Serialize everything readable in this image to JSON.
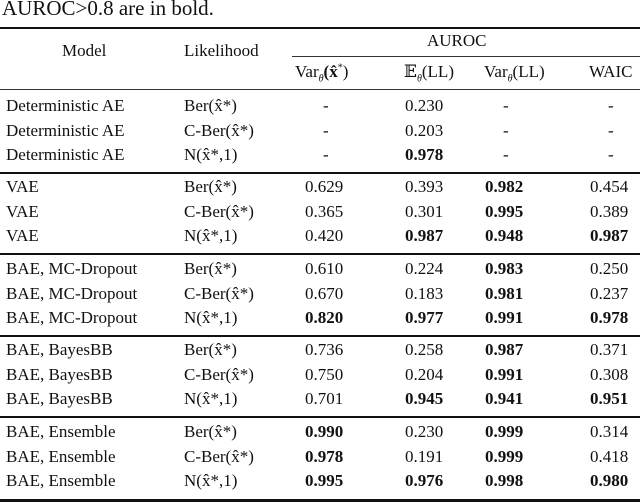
{
  "caption": "AUROC>0.8 are in bold.",
  "header": {
    "model": "Model",
    "likelihood": "Likelihood",
    "auroc_group": "AUROC",
    "columns": [
      {
        "base": "Var",
        "sub": "θ",
        "arg": "(x̂",
        "sup": "*",
        "close": ")"
      },
      {
        "base": "𝔼",
        "sub": "θ",
        "arg": "(LL)"
      },
      {
        "base": "Var",
        "sub": "θ",
        "arg": "(LL)"
      },
      {
        "label": "WAIC"
      }
    ]
  },
  "rows": [
    {
      "model": "Deterministic AE",
      "likelihood": "Ber(x̂*)",
      "values": [
        "-",
        "0.230",
        "-",
        "-"
      ],
      "bold": [
        false,
        false,
        false,
        false
      ]
    },
    {
      "model": "Deterministic AE",
      "likelihood": "C-Ber(x̂*)",
      "values": [
        "-",
        "0.203",
        "-",
        "-"
      ],
      "bold": [
        false,
        false,
        false,
        false
      ]
    },
    {
      "model": "Deterministic AE",
      "likelihood": "N(x̂*,1)",
      "values": [
        "-",
        "0.978",
        "-",
        "-"
      ],
      "bold": [
        false,
        true,
        false,
        false
      ]
    },
    {
      "model": "VAE",
      "likelihood": "Ber(x̂*)",
      "values": [
        "0.629",
        "0.393",
        "0.982",
        "0.454"
      ],
      "bold": [
        false,
        false,
        true,
        false
      ]
    },
    {
      "model": "VAE",
      "likelihood": "C-Ber(x̂*)",
      "values": [
        "0.365",
        "0.301",
        "0.995",
        "0.389"
      ],
      "bold": [
        false,
        false,
        true,
        false
      ]
    },
    {
      "model": "VAE",
      "likelihood": "N(x̂*,1)",
      "values": [
        "0.420",
        "0.987",
        "0.948",
        "0.987"
      ],
      "bold": [
        false,
        true,
        true,
        true
      ]
    },
    {
      "model": "BAE, MC-Dropout",
      "likelihood": "Ber(x̂*)",
      "values": [
        "0.610",
        "0.224",
        "0.983",
        "0.250"
      ],
      "bold": [
        false,
        false,
        true,
        false
      ]
    },
    {
      "model": "BAE, MC-Dropout",
      "likelihood": "C-Ber(x̂*)",
      "values": [
        "0.670",
        "0.183",
        "0.981",
        "0.237"
      ],
      "bold": [
        false,
        false,
        true,
        false
      ]
    },
    {
      "model": "BAE, MC-Dropout",
      "likelihood": "N(x̂*,1)",
      "values": [
        "0.820",
        "0.977",
        "0.991",
        "0.978"
      ],
      "bold": [
        true,
        true,
        true,
        true
      ]
    },
    {
      "model": "BAE, BayesBB",
      "likelihood": "Ber(x̂*)",
      "values": [
        "0.736",
        "0.258",
        "0.987",
        "0.371"
      ],
      "bold": [
        false,
        false,
        true,
        false
      ]
    },
    {
      "model": "BAE, BayesBB",
      "likelihood": "C-Ber(x̂*)",
      "values": [
        "0.750",
        "0.204",
        "0.991",
        "0.308"
      ],
      "bold": [
        false,
        false,
        true,
        false
      ]
    },
    {
      "model": "BAE, BayesBB",
      "likelihood": "N(x̂*,1)",
      "values": [
        "0.701",
        "0.945",
        "0.941",
        "0.951"
      ],
      "bold": [
        false,
        true,
        true,
        true
      ]
    },
    {
      "model": "BAE, Ensemble",
      "likelihood": "Ber(x̂*)",
      "values": [
        "0.990",
        "0.230",
        "0.999",
        "0.314"
      ],
      "bold": [
        true,
        false,
        true,
        false
      ]
    },
    {
      "model": "BAE, Ensemble",
      "likelihood": "C-Ber(x̂*)",
      "values": [
        "0.978",
        "0.191",
        "0.999",
        "0.418"
      ],
      "bold": [
        true,
        false,
        true,
        false
      ]
    },
    {
      "model": "BAE, Ensemble",
      "likelihood": "N(x̂*,1)",
      "values": [
        "0.995",
        "0.976",
        "0.998",
        "0.980"
      ],
      "bold": [
        true,
        true,
        true,
        true
      ]
    }
  ]
}
